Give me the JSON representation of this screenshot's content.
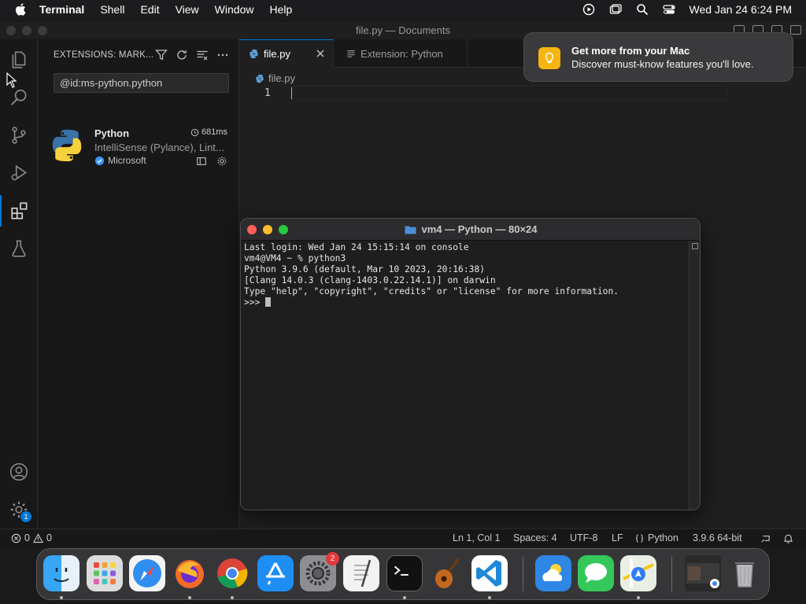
{
  "menubar": {
    "app_name": "Terminal",
    "menus": [
      "Shell",
      "Edit",
      "View",
      "Window",
      "Help"
    ],
    "datetime": "Wed Jan 24  6:24 PM"
  },
  "vscode": {
    "window_title": "file.py — Documents",
    "sidebar": {
      "header": "EXTENSIONS: MARK...",
      "search_value": "@id:ms-python.python",
      "extension": {
        "name": "Python",
        "activation_time": "681ms",
        "description": "IntelliSense (Pylance), Lint...",
        "publisher": "Microsoft"
      }
    },
    "tabs": [
      {
        "label": "file.py",
        "active": true
      },
      {
        "label": "Extension: Python",
        "active": false
      }
    ],
    "breadcrumb": "file.py",
    "line_number": "1",
    "accounts_badge": "1",
    "statusbar": {
      "errors": "0",
      "warnings": "0",
      "position": "Ln 1, Col 1",
      "spaces": "Spaces: 4",
      "encoding": "UTF-8",
      "eol": "LF",
      "language": "Python",
      "interpreter": "3.9.6 64-bit"
    }
  },
  "notification": {
    "title": "Get more from your Mac",
    "body": "Discover must-know features you'll love."
  },
  "terminal": {
    "title": "vm4 — Python — 80×24",
    "lines": [
      "Last login: Wed Jan 24 15:15:14 on console",
      "vm4@VM4 ~ % python3",
      "Python 3.9.6 (default, Mar 10 2023, 20:16:38)",
      "[Clang 14.0.3 (clang-1403.0.22.14.1)] on darwin",
      "Type \"help\", \"copyright\", \"credits\" or \"license\" for more information."
    ],
    "prompt": ">>> "
  },
  "dock": {
    "settings_badge": "2",
    "apps": [
      "finder",
      "launchpad",
      "safari",
      "firefox",
      "chrome",
      "app-store",
      "system-settings",
      "textedit",
      "terminal",
      "garageband",
      "vscode",
      "weather",
      "messages",
      "maps",
      "preview-window",
      "trash"
    ]
  },
  "colors": {
    "accent": "#0078d4",
    "notification_icon": "#f6b40e",
    "close_dot": "#ff5f57",
    "min_dot": "#febc2e",
    "max_dot": "#28c840"
  }
}
